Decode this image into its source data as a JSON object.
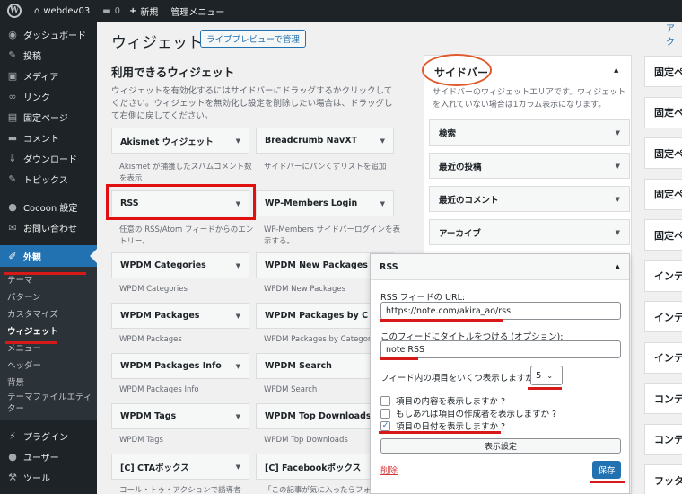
{
  "adminbar": {
    "site_name": "webdev03",
    "comments_count": "0",
    "new_label": "新規",
    "admin_menu_label": "管理メニュー"
  },
  "menu": {
    "items_top": [
      {
        "label": "ダッシュボード",
        "icon": "dashboard-icon",
        "glyph": "◉"
      },
      {
        "label": "投稿",
        "icon": "pin-icon",
        "glyph": "✎"
      },
      {
        "label": "メディア",
        "icon": "media-icon",
        "glyph": "▣"
      },
      {
        "label": "リンク",
        "icon": "link-icon",
        "glyph": "∞"
      },
      {
        "label": "固定ページ",
        "icon": "page-icon",
        "glyph": "▤"
      },
      {
        "label": "コメント",
        "icon": "comment-icon",
        "glyph": "▬"
      },
      {
        "label": "ダウンロード",
        "icon": "download-icon",
        "glyph": "⇓"
      },
      {
        "label": "トピックス",
        "icon": "pin-icon",
        "glyph": "✎"
      }
    ],
    "items_mid": [
      {
        "label": "Cocoon 設定",
        "icon": "cocoon-icon",
        "glyph": "●"
      },
      {
        "label": "お問い合わせ",
        "icon": "mail-icon",
        "glyph": "✉"
      }
    ],
    "active": {
      "label": "外観",
      "icon": "paintbrush-icon",
      "glyph": "✐"
    },
    "submenu": [
      "テーマ",
      "パターン",
      "カスタマイズ",
      "ウィジェット",
      "メニュー",
      "ヘッダー",
      "背景",
      "テーマファイルエディター"
    ],
    "items_bottom": [
      {
        "label": "プラグイン",
        "icon": "plugin-icon",
        "glyph": "⚡"
      },
      {
        "label": "ユーザー",
        "icon": "user-icon",
        "glyph": "●"
      },
      {
        "label": "ツール",
        "icon": "tool-icon",
        "glyph": "⚒"
      }
    ]
  },
  "page": {
    "title": "ウィジェット",
    "live_preview_button": "ライブプレビューで管理",
    "top_right_link": "アク"
  },
  "available": {
    "title": "利用できるウィジェット",
    "description": "ウィジェットを有効化するにはサイドバーにドラッグするかクリックしてください。ウィジェットを無効化し設定を削除したい場合は、ドラッグして右側に戻してください。",
    "widgets": [
      {
        "name": "Akismet ウィジェット",
        "desc": "Akismet が捕獲したスパムコメント数を表示"
      },
      {
        "name": "Breadcrumb NavXT",
        "desc": "サイドバーにパンくずリストを追加"
      },
      {
        "name": "RSS",
        "desc": "任意の RSS/Atom フィードからのエントリー。"
      },
      {
        "name": "WP-Members Login",
        "desc": "WP-Members サイドバーログインを表示する。"
      },
      {
        "name": "WPDM Categories",
        "desc": "WPDM Categories"
      },
      {
        "name": "WPDM New Packages",
        "desc": "WPDM New Packages"
      },
      {
        "name": "WPDM Packages",
        "desc": "WPDM Packages"
      },
      {
        "name": "WPDM Packages by C",
        "desc": "WPDM Packages by Category"
      },
      {
        "name": "WPDM Packages Info",
        "desc": "WPDM Packages Info"
      },
      {
        "name": "WPDM Search",
        "desc": "WPDM Search"
      },
      {
        "name": "WPDM Tags",
        "desc": "WPDM Tags"
      },
      {
        "name": "WPDM Top Downloads",
        "desc": "WPDM Top Downloads"
      },
      {
        "name": "[C] CTAボックス",
        "desc": "コール・トゥ・アクションで誘導者"
      },
      {
        "name": "[C] Facebookボックス",
        "desc": "「この記事が気に入ったらフォロー"
      }
    ]
  },
  "sidebar": {
    "title": "サイドバー",
    "description": "サイドバーのウィジェットエリアです。ウィジェットを入れていない場合は1カラム表示になります。",
    "widgets": [
      "検索",
      "最近の投稿",
      "最近のコメント",
      "アーカイブ"
    ]
  },
  "rss_form": {
    "title": "RSS",
    "url_label": "RSS フィードの URL:",
    "url_value": "https://note.com/akira_ao/rss",
    "title_label": "このフィードにタイトルをつける (オプション):",
    "title_value": "note RSS",
    "count_label": "フィード内の項目をいくつ表示しますか ?",
    "count_value": "5",
    "checkboxes": [
      {
        "label": "項目の内容を表示しますか ?",
        "checked": false
      },
      {
        "label": "もしあれば項目の作成者を表示しますか ?",
        "checked": false
      },
      {
        "label": "項目の日付を表示しますか ?",
        "checked": true
      }
    ],
    "display_settings_button": "表示設定",
    "delete_link": "削除",
    "save_button": "保存"
  },
  "right_column": [
    "固定ペ",
    "固定ペ",
    "固定ペ",
    "固定ペ",
    "固定ペ",
    "インテ",
    "インテ",
    "インテ",
    "コンテ",
    "コンテ",
    "フッタ"
  ],
  "colors": {
    "accent": "#2271b1",
    "admin_dark": "#1d2327",
    "annotation_red": "#e01010",
    "annotation_orange": "#e0592b"
  }
}
